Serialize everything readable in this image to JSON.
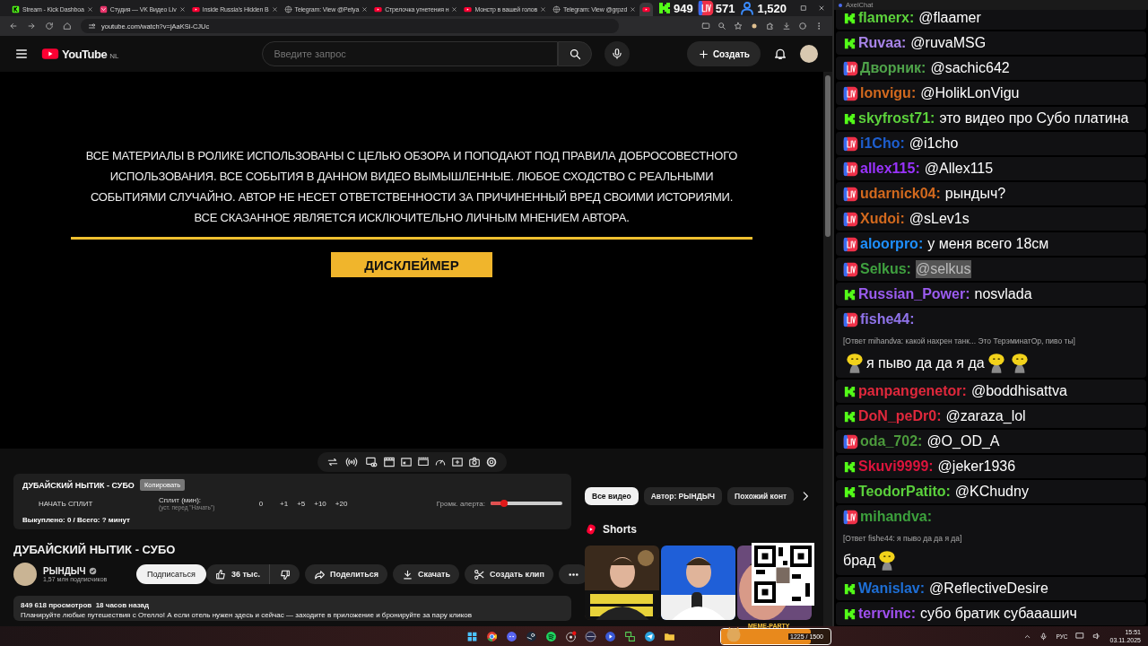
{
  "browser": {
    "tabs": [
      {
        "kind": "kick",
        "title": "Stream - Kick Dashboa",
        "selected": false
      },
      {
        "kind": "vk",
        "title": "Студия — VK Видео Liv",
        "selected": false
      },
      {
        "kind": "youtube",
        "title": "Inside Russia's Hidden B",
        "selected": false
      },
      {
        "kind": "globe",
        "title": "Telegram: View @Petya",
        "selected": false
      },
      {
        "kind": "youtube",
        "title": "Стрелочка угнетения н",
        "selected": false
      },
      {
        "kind": "youtube",
        "title": "Монстр в вашей голов",
        "selected": false
      },
      {
        "kind": "globe",
        "title": "Telegram: View @grpzd",
        "selected": false
      },
      {
        "kind": "youtube",
        "selected": true
      }
    ],
    "url": "youtube.com/watch?v=jAaKSi-CJUc"
  },
  "stream_stats": [
    {
      "kind": "kick",
      "count": "949"
    },
    {
      "kind": "live",
      "count": "571"
    },
    {
      "kind": "viewers",
      "count": "1,520"
    }
  ],
  "youtube": {
    "logo_text": "YouTube",
    "region": "NL",
    "search_placeholder": "Введите запрос",
    "create_label": "Создать",
    "video": {
      "disclaimer": "ВСЕ МАТЕРИАЛЫ В РОЛИКЕ ИСПОЛЬЗОВАНЫ С ЦЕЛЬЮ ОБЗОРА И ПОПОДАЮТ ПОД ПРАВИЛА ДОБРОСОВЕСТНОГО ИСПОЛЬЗОВАНИЯ. ВСЕ СОБЫТИЯ В ДАННОМ ВИДЕО ВЫМЫШЛЕННЫЕ. ЛЮБОЕ СХОДСТВО С РЕАЛЬНЫМИ СОБЫТИЯМИ СЛУЧАЙНО. АВТОР НЕ НЕСЕТ ОТВЕТСТВЕННОСТИ ЗА ПРИЧИНЕННЫЙ ВРЕД СВОИМИ ИСТОРИЯМИ. ВСЕ СКАЗАННОЕ ЯВЛЯЕТСЯ ИСКЛЮЧИТЕЛЬНО ЛИЧНЫМ МНЕНИЕМ АВТОРА.",
      "banner": "ДИСКЛЕЙМЕР"
    },
    "split_panel": {
      "title": "ДУБАЙСКИЙ НЫТИК - СУБО",
      "copy_button": "Копировать",
      "start_button": "НАЧАТЬ СПЛИТ",
      "split_label": "Сплит (мин):",
      "split_hint": "(уст. перед \"Начать\")",
      "value": "0",
      "increments": [
        "+1",
        "+5",
        "+10",
        "+20"
      ],
      "volume_label": "Громк. алерта:",
      "volume": {
        "level": 0.19
      },
      "summary": "Выкуплено: 0 / Всего: ? минут"
    },
    "title": "ДУБАЙСКИЙ НЫТИК - СУБО",
    "channel": {
      "name": "РЫНДЫЧ",
      "verified": true,
      "subscribers": "1,57 млн подписчиков",
      "subscribe": "Подписаться"
    },
    "actions": {
      "likes": "36 тыс.",
      "share": "Поделиться",
      "download": "Скачать",
      "clip": "Создать клип"
    },
    "description": {
      "meta": "849 618 просмотров  18 часов назад",
      "text": "Планируйте любые путешествия с Отелло! А если отель нужен здесь и сейчас — заходите в приложение и бронируйте за пару кликов"
    },
    "chips": [
      {
        "label": "Все видео",
        "selected": true
      },
      {
        "label": "Автор: РЫНДЫЧ",
        "selected": false
      },
      {
        "label": "Похожий конт",
        "selected": false
      }
    ],
    "shorts_heading": "Shorts"
  },
  "chat": {
    "title": "AxelChat",
    "messages": [
      {
        "kind": "kick",
        "author": "flamerx:",
        "color": "#5cd13c",
        "text": "@flaamer",
        "highlighted": false
      },
      {
        "kind": "kick",
        "author": "Ruvaa:",
        "color": "#a884e8",
        "text": "@ruvaMSG",
        "highlighted": false
      },
      {
        "kind": "live",
        "author": "Дворник:",
        "color": "#4fa34a",
        "text": "@sachic642",
        "highlighted": false
      },
      {
        "kind": "live",
        "author": "lonvigu:",
        "color": "#d2691e",
        "text": "@HolikLonVigu",
        "highlighted": false
      },
      {
        "kind": "kick",
        "author": "skyfrost71:",
        "color": "#5cd13c",
        "text": "это видео про Субо платина",
        "highlighted": false
      },
      {
        "kind": "live",
        "author": "i1Cho:",
        "color": "#1e5fd0",
        "text": "@i1cho",
        "highlighted": false
      },
      {
        "kind": "live",
        "author": "allex115:",
        "color": "#9a33ff",
        "text": "@Allex115",
        "highlighted": false
      },
      {
        "kind": "live",
        "author": "udarnick04:",
        "color": "#d2691e",
        "text": "рындыч?",
        "highlighted": false
      },
      {
        "kind": "live",
        "author": "Xudoi:",
        "color": "#d2691e",
        "text": "@sLev1s",
        "highlighted": false
      },
      {
        "kind": "live",
        "author": "aloorpro:",
        "color": "#1e90ff",
        "text": "у меня всего 18см",
        "highlighted": false
      },
      {
        "kind": "live",
        "author": "Selkus:",
        "color": "#3fa03f",
        "text": "@selkus",
        "highlighted": true
      },
      {
        "kind": "kick",
        "author": "Russian_Power:",
        "color": "#9b5cf0",
        "text": "nosvlada",
        "highlighted": false
      },
      {
        "kind": "live",
        "author": "fishe44:",
        "color": "#8f73ea",
        "reply": "[Ответ mihandva: какой нахрен танк... Это ТерэминатОр, пиво ты]",
        "content": [
          {
            "kind": "emote"
          },
          {
            "kind": "text",
            "text": "я пыво да да я да"
          },
          {
            "kind": "emote"
          },
          {
            "kind": "emote"
          }
        ],
        "highlighted": false
      },
      {
        "kind": "kick",
        "author": "panpangenetor:",
        "color": "#e0283c",
        "text": "@boddhisattva",
        "highlighted": false
      },
      {
        "kind": "kick",
        "author": "DoN_peDr0:",
        "color": "#e0283c",
        "text": "@zaraza_lol",
        "highlighted": false
      },
      {
        "kind": "live",
        "author": "oda_702:",
        "color": "#4c9a3c",
        "text": "@O_OD_A",
        "highlighted": false
      },
      {
        "kind": "kick",
        "author": "Skuvi9999:",
        "color": "#dc143c",
        "text": "@jeker1936",
        "highlighted": false
      },
      {
        "kind": "kick",
        "author": "TeodorPatito:",
        "color": "#5bd13c",
        "text": "@KChudny",
        "highlighted": false
      },
      {
        "kind": "live",
        "author": "mihandva:",
        "color": "#3ca03c",
        "reply": "[Ответ fishe44: я пыво да да я да]",
        "content": [
          {
            "kind": "text",
            "text": "брад"
          },
          {
            "kind": "emote"
          }
        ],
        "highlighted": false
      },
      {
        "kind": "kick",
        "author": "Wanislav:",
        "color": "#1e6fd6",
        "text": "@ReflectiveDesire",
        "highlighted": false
      },
      {
        "kind": "kick",
        "author": "terrvinc:",
        "color": "#a050f0",
        "text": "субо братик субааашич",
        "highlighted": false
      }
    ]
  },
  "taskbar": {
    "meme_party": {
      "label": "MEME-PARTY",
      "level": 0.82,
      "reading": "1225 / 1500"
    },
    "language": "РУС",
    "time": "15:51",
    "date": "03.11.2025"
  }
}
